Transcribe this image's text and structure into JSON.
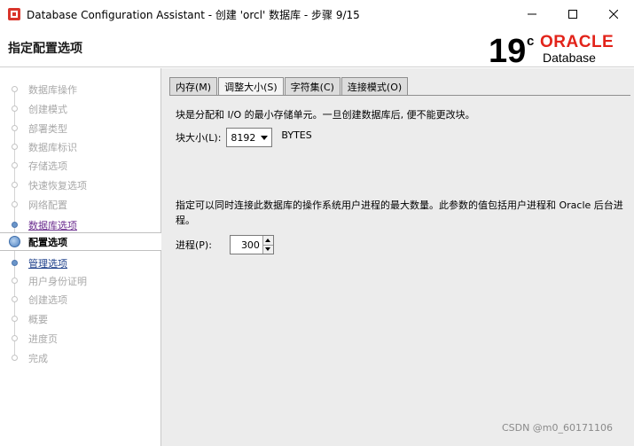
{
  "window": {
    "title": "Database Configuration Assistant - 创建 'orcl' 数据库 - 步骤 9/15"
  },
  "header": {
    "title": "指定配置选项",
    "logo": {
      "version": "19",
      "superscript": "c",
      "brand": "ORACLE",
      "product": "Database",
      "brand_color": "#e2231a"
    }
  },
  "sidebar": {
    "steps": [
      {
        "label": "数据库操作",
        "state": "disabled"
      },
      {
        "label": "创建模式",
        "state": "disabled"
      },
      {
        "label": "部署类型",
        "state": "disabled"
      },
      {
        "label": "数据库标识",
        "state": "disabled"
      },
      {
        "label": "存储选项",
        "state": "disabled"
      },
      {
        "label": "快速恢复选项",
        "state": "disabled"
      },
      {
        "label": "网络配置",
        "state": "disabled"
      },
      {
        "label": "数据库选项",
        "state": "done"
      },
      {
        "label": "配置选项",
        "state": "current"
      },
      {
        "label": "管理选项",
        "state": "link"
      },
      {
        "label": "用户身份证明",
        "state": "disabled"
      },
      {
        "label": "创建选项",
        "state": "disabled"
      },
      {
        "label": "概要",
        "state": "disabled"
      },
      {
        "label": "进度页",
        "state": "disabled"
      },
      {
        "label": "完成",
        "state": "disabled"
      }
    ]
  },
  "tabs": [
    {
      "label": "内存(M)",
      "active": false
    },
    {
      "label": "调整大小(S)",
      "active": true
    },
    {
      "label": "字符集(C)",
      "active": false
    },
    {
      "label": "连接模式(O)",
      "active": false
    }
  ],
  "sizing": {
    "block_desc": "块是分配和 I/O 的最小存储单元。一旦创建数据库后, 便不能更改块。",
    "block_size_label": "块大小(L):",
    "block_size_value": "8192",
    "block_size_unit": "BYTES",
    "process_desc": "指定可以同时连接此数据库的操作系统用户进程的最大数量。此参数的值包括用户进程和 Oracle 后台进程。",
    "process_label": "进程(P):",
    "process_value": "300"
  },
  "watermark": "CSDN @m0_60171106"
}
